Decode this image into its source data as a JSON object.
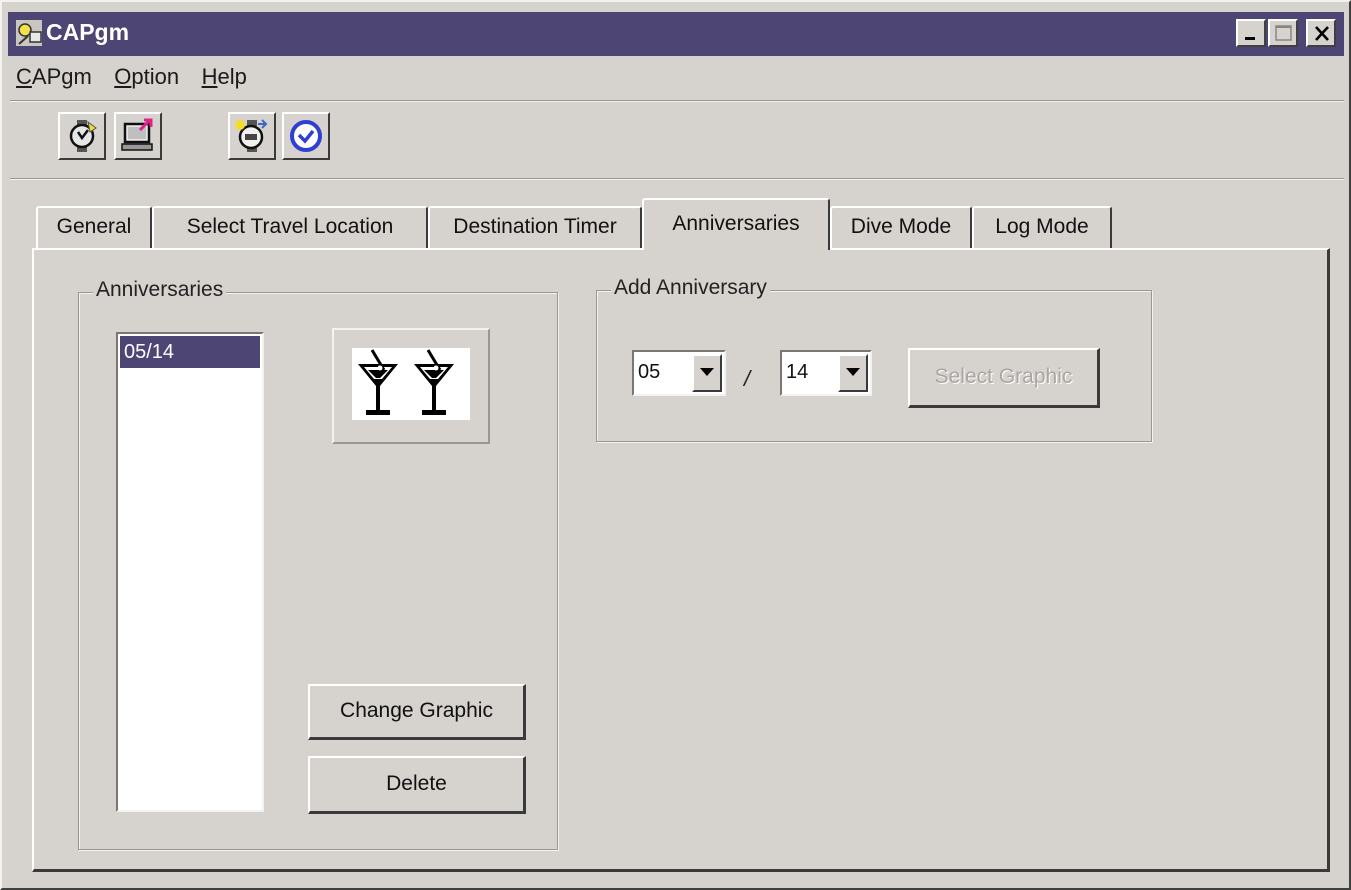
{
  "window": {
    "title": "CAPgm",
    "controls": {
      "minimize": "minimize",
      "maximize": "maximize",
      "close": "close"
    }
  },
  "menu": [
    {
      "label": "CAPgm",
      "accel": "C",
      "rest": "APgm"
    },
    {
      "label": "Option",
      "accel": "O",
      "rest": "ption"
    },
    {
      "label": "Help",
      "accel": "H",
      "rest": "elp"
    }
  ],
  "toolbar": {
    "icons": [
      "watch-download-icon",
      "computer-upload-icon",
      "watch-settings-icon",
      "clock-icon"
    ]
  },
  "tabs": [
    {
      "label": "General"
    },
    {
      "label": "Select Travel Location"
    },
    {
      "label": "Destination Timer"
    },
    {
      "label": "Anniversaries",
      "active": true
    },
    {
      "label": "Dive Mode"
    },
    {
      "label": "Log Mode"
    }
  ],
  "anniversaries_group": {
    "label": "Anniversaries",
    "list_items": [
      "05/14"
    ],
    "selected_index": 0,
    "graphic": "martini-glasses-icon",
    "change_graphic_label": "Change Graphic",
    "delete_label": "Delete"
  },
  "add_group": {
    "label": "Add Anniversary",
    "month_value": "05",
    "separator": "/",
    "day_value": "14",
    "select_graphic_label": "Select Graphic",
    "select_graphic_enabled": false
  },
  "colors": {
    "titlebar": "#4d4574",
    "face": "#d6d2ce",
    "selection": "#4d4574"
  }
}
